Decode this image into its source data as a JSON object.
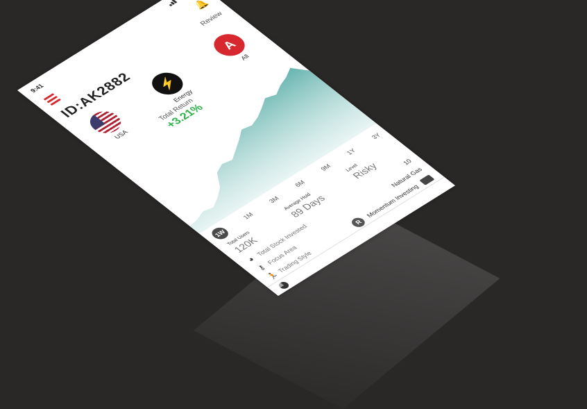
{
  "status": {
    "time": "9:41"
  },
  "header": {
    "account_id": "ID:AK2882",
    "review_label": "Review"
  },
  "categories": [
    {
      "label": "USA",
      "icon": "usa-flag-icon"
    },
    {
      "label": "Energy",
      "icon": "lightning-icon",
      "glyph": "⚡"
    },
    {
      "label": "All",
      "icon": "all-letter-icon",
      "glyph": "A"
    }
  ],
  "total_return": {
    "label": "Total Return",
    "value": "+3.21%"
  },
  "chart_data": {
    "type": "area",
    "x": [
      0,
      1,
      2,
      3,
      4,
      5,
      6,
      7,
      8,
      9,
      10,
      11,
      12,
      13,
      14,
      15,
      16,
      17,
      18,
      19,
      20
    ],
    "values": [
      12,
      14,
      18,
      16,
      22,
      30,
      45,
      50,
      48,
      55,
      62,
      70,
      68,
      72,
      78,
      85,
      82,
      88,
      92,
      98,
      85
    ],
    "fill_color": "#7fc1bd",
    "ylim": [
      0,
      100
    ],
    "title": "",
    "xlabel": "",
    "ylabel": ""
  },
  "periods": [
    "1W",
    "1M",
    "3M",
    "6M",
    "9M",
    "1Y",
    "3Y"
  ],
  "active_period": "1W",
  "stats": [
    {
      "label": "Total Users",
      "value": "120K"
    },
    {
      "label": "Average Hold",
      "value": "89 Days"
    },
    {
      "label": "Level",
      "value": "Risky"
    }
  ],
  "details": [
    {
      "label": "Total Stock Invested",
      "value": "10",
      "icon": "pie-chart-icon"
    },
    {
      "label": "Focus Area",
      "value": "Natural Gas",
      "icon": "key-icon"
    },
    {
      "label": "Trading Style",
      "value": "Momentum Investing",
      "icon": "running-person-icon"
    }
  ],
  "colors": {
    "accent_red": "#d8282f",
    "positive_green": "#2fb24a",
    "chart_teal": "#7fc1bd",
    "background": "#2a2727"
  }
}
